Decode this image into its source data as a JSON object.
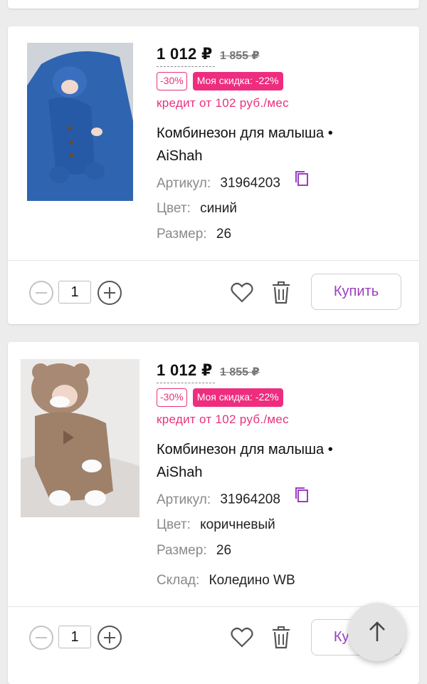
{
  "products": [
    {
      "price_current": "1 012 ₽",
      "price_old": "1 855 ₽",
      "discount_badge": "-30%",
      "my_discount_badge": "Моя скидка: -22%",
      "credit": "кредит от 102 руб./мес",
      "title_line1": "Комбинезон для малыша •",
      "title_line2": "AiShah",
      "article_label": "Артикул:",
      "article_value": "31964203",
      "color_label": "Цвет:",
      "color_value": "синий",
      "size_label": "Размер:",
      "size_value": "26",
      "quantity": "1",
      "buy_label": "Купить",
      "photo_color": "#2f64b0"
    },
    {
      "price_current": "1 012 ₽",
      "price_old": "1 855 ₽",
      "discount_badge": "-30%",
      "my_discount_badge": "Моя скидка: -22%",
      "credit": "кредит от 102 руб./мес",
      "title_line1": "Комбинезон для малыша •",
      "title_line2": "AiShah",
      "article_label": "Артикул:",
      "article_value": "31964208",
      "color_label": "Цвет:",
      "color_value": "коричневый",
      "size_label": "Размер:",
      "size_value": "26",
      "warehouse_label": "Склад:",
      "warehouse_value": "Коледино WB",
      "quantity": "1",
      "buy_label": "Купить",
      "photo_color": "#a88a74"
    }
  ],
  "colors": {
    "accent_pink": "#ee2d7f",
    "accent_purple": "#9b3fbf"
  }
}
